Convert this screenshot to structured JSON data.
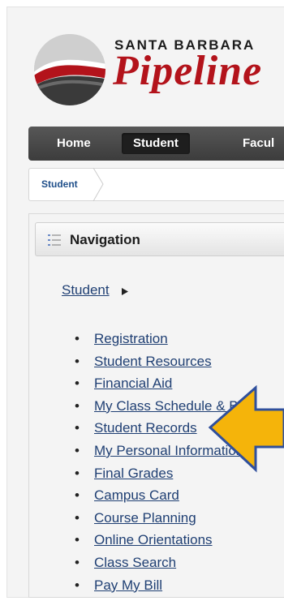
{
  "brand": {
    "line1": "SANTA BARBARA",
    "line2": "Pipeline"
  },
  "nav": {
    "tabs": [
      {
        "label": "Home",
        "active": false
      },
      {
        "label": "Student",
        "active": true
      },
      {
        "label": "Facul",
        "active": false
      }
    ]
  },
  "breadcrumb": {
    "current": "Student"
  },
  "panel": {
    "title": "Navigation",
    "section_link": "Student",
    "items": [
      {
        "label": "Registration"
      },
      {
        "label": "Student Resources"
      },
      {
        "label": "Financial Aid"
      },
      {
        "label": "My Class Schedule & Bill"
      },
      {
        "label": "Student Records"
      },
      {
        "label": "My Personal Information"
      },
      {
        "label": "Final Grades"
      },
      {
        "label": "Campus Card"
      },
      {
        "label": "Course Planning"
      },
      {
        "label": "Online Orientations"
      },
      {
        "label": "Class Search"
      },
      {
        "label": "Pay My Bill"
      }
    ]
  },
  "colors": {
    "brand_red": "#b3131b",
    "nav_dark": "#3c3c3c",
    "link": "#1f3f73",
    "arrow": "#f5b40a"
  },
  "icons": {
    "logo": "wave-logo-icon",
    "list": "list-icon",
    "expand": "triangle-right-icon",
    "pointer": "arrow-left-icon"
  }
}
